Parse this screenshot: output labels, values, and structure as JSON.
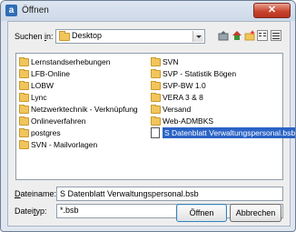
{
  "window": {
    "title": "Öffnen",
    "close_glyph": "✕"
  },
  "look_in": {
    "label_prefix": "Suchen ",
    "label_mnemonic": "i",
    "label_suffix": "n:",
    "value": "Desktop"
  },
  "toolbar": {
    "icons": [
      "up-folder-icon",
      "home-icon",
      "new-folder-icon",
      "list-view-icon",
      "details-view-icon"
    ]
  },
  "files": [
    {
      "name": "Lernstandserhebungen",
      "type": "folder"
    },
    {
      "name": "LFB-Online",
      "type": "folder"
    },
    {
      "name": "LOBW",
      "type": "folder"
    },
    {
      "name": "Lync",
      "type": "folder"
    },
    {
      "name": "Netzwerktechnik - Verknüpfung",
      "type": "folder"
    },
    {
      "name": "Onlineverfahren",
      "type": "folder"
    },
    {
      "name": "postgres",
      "type": "folder"
    },
    {
      "name": "SVN - Mailvorlagen",
      "type": "folder"
    },
    {
      "name": "SVN",
      "type": "folder"
    },
    {
      "name": "SVP - Statistik Bögen",
      "type": "folder"
    },
    {
      "name": "SVP-BW 1.0",
      "type": "folder"
    },
    {
      "name": "VERA 3 & 8",
      "type": "folder"
    },
    {
      "name": "Versand",
      "type": "folder"
    },
    {
      "name": "Web-ADMBKS",
      "type": "folder"
    },
    {
      "name": "S Datenblatt Verwaltungspersonal.bsb",
      "type": "file",
      "selected": true
    }
  ],
  "filename": {
    "label_mnemonic": "D",
    "label_rest": "ateiname:",
    "value": "S Datenblatt Verwaltungspersonal.bsb"
  },
  "filetype": {
    "label_prefix": "Datei",
    "label_mnemonic": "t",
    "label_suffix": "yp:",
    "value": "*.bsb"
  },
  "buttons": {
    "open": "Öffnen",
    "cancel": "Abbrechen"
  }
}
